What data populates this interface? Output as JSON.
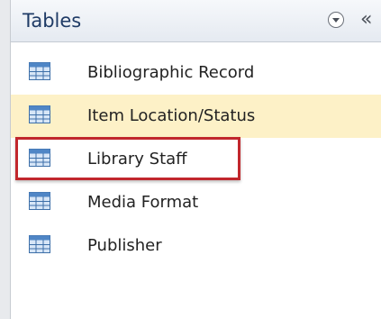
{
  "pane": {
    "title": "Tables",
    "menu_icon": "chevron-down-circle-icon",
    "collapse_icon": "double-chevron-left-icon",
    "collapse_glyph": "«"
  },
  "tables": [
    {
      "label": "Bibliographic Record",
      "icon": "table-icon",
      "selected": false
    },
    {
      "label": "Item Location/Status",
      "icon": "table-icon",
      "selected": true
    },
    {
      "label": "Library Staff",
      "icon": "table-icon",
      "selected": false,
      "highlighted": true
    },
    {
      "label": "Media Format",
      "icon": "table-icon",
      "selected": false
    },
    {
      "label": "Publisher",
      "icon": "table-icon",
      "selected": false
    }
  ],
  "colors": {
    "selected_bg": "#fdf1c7",
    "highlight_border": "#c1272d",
    "title_text": "#1f3b66"
  }
}
